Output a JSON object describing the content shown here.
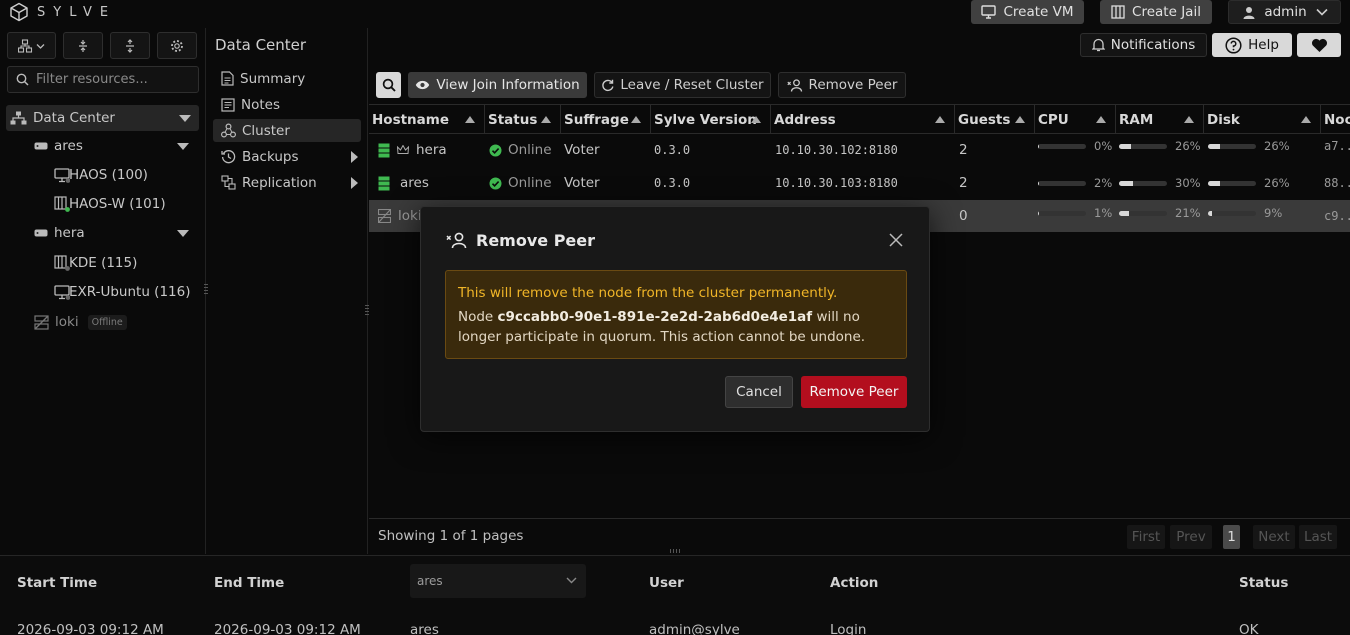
{
  "brand": {
    "name": "SYLVE"
  },
  "topbar": {
    "create_vm": "Create VM",
    "create_jail": "Create Jail",
    "user": "admin"
  },
  "header": {
    "title": "Data Center",
    "notifications": "Notifications",
    "help": "Help"
  },
  "filter": {
    "placeholder": "Filter resources..."
  },
  "tree": {
    "root": "Data Center",
    "nodes": [
      {
        "name": "ares",
        "items": [
          {
            "label": "HAOS (100)"
          },
          {
            "label": "HAOS-W (101)"
          }
        ]
      },
      {
        "name": "hera",
        "items": [
          {
            "label": "KDE (115)"
          },
          {
            "label": "EXR-Ubuntu (116)"
          }
        ]
      },
      {
        "name": "loki",
        "badge": "Offline"
      }
    ]
  },
  "nav": {
    "items": [
      {
        "label": "Summary"
      },
      {
        "label": "Notes"
      },
      {
        "label": "Cluster"
      },
      {
        "label": "Backups"
      },
      {
        "label": "Replication"
      }
    ]
  },
  "actions": {
    "view_join": "View Join Information",
    "leave_reset": "Leave / Reset Cluster",
    "remove_peer": "Remove Peer"
  },
  "table": {
    "columns": [
      "Hostname",
      "Status",
      "Suffrage",
      "Sylve Version",
      "Address",
      "Guests",
      "CPU",
      "RAM",
      "Disk",
      "Noc"
    ],
    "rows": [
      {
        "hostname": "hera",
        "status": "Online",
        "suffrage": "Voter",
        "version": "0.3.0",
        "address": "10.10.30.102:8180",
        "guests": "2",
        "cpu": 0,
        "cpu_label": "0%",
        "ram": 26,
        "ram_label": "26%",
        "disk": 26,
        "disk_label": "26%",
        "node": "a7..."
      },
      {
        "hostname": "ares",
        "status": "Online",
        "suffrage": "Voter",
        "version": "0.3.0",
        "address": "10.10.30.103:8180",
        "guests": "2",
        "cpu": 2,
        "cpu_label": "2%",
        "ram": 30,
        "ram_label": "30%",
        "disk": 26,
        "disk_label": "26%",
        "node": "88..."
      },
      {
        "hostname": "loki",
        "status": "",
        "suffrage": "",
        "version": "",
        "address": "",
        "guests": "0",
        "cpu": 1,
        "cpu_label": "1%",
        "ram": 21,
        "ram_label": "21%",
        "disk": 9,
        "disk_label": "9%",
        "node": "c9..."
      }
    ]
  },
  "pager": {
    "text": "Showing 1 of 1 pages",
    "first": "First",
    "prev": "Prev",
    "current": "1",
    "next": "Next",
    "last": "Last"
  },
  "modal": {
    "title": "Remove Peer",
    "alert_title": "This will remove the node from the cluster permanently.",
    "alert_prefix": "Node",
    "node_id": "c9ccabb0-90e1-891e-2e2d-2ab6d0e4e1af",
    "alert_suffix": "will no longer participate in quorum. This action cannot be undone.",
    "cancel": "Cancel",
    "confirm": "Remove Peer"
  },
  "log": {
    "headers": {
      "start": "Start Time",
      "end": "End Time",
      "user": "User",
      "action": "Action",
      "status": "Status"
    },
    "node_filter": "ares",
    "row": {
      "start": "2026-09-03 09:12 AM",
      "end": "2026-09-03 09:12 AM",
      "node": "ares",
      "user": "admin@sylve",
      "action": "Login",
      "status": "OK"
    }
  },
  "colors": {
    "online": "#3fb950",
    "danger": "#b30e1e",
    "warning_text": "#f1b628"
  }
}
